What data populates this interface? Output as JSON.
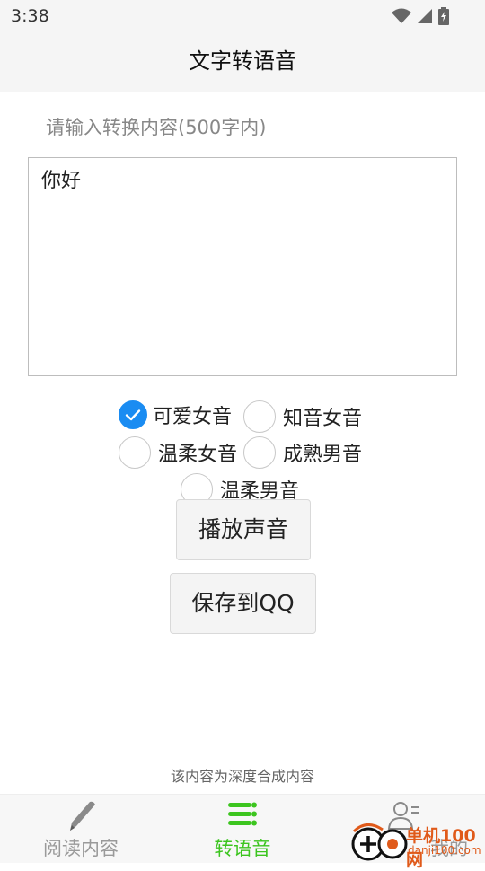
{
  "status_bar": {
    "time": "3:38"
  },
  "app_bar": {
    "title": "文字转语音"
  },
  "form": {
    "prompt_label": "请输入转换内容(500字内)",
    "text_value": "你好"
  },
  "voices": {
    "options": [
      {
        "label": "可爱女音",
        "checked": true
      },
      {
        "label": "知音女音",
        "checked": false
      },
      {
        "label": "温柔女音",
        "checked": false
      },
      {
        "label": "成熟男音",
        "checked": false
      },
      {
        "label": "温柔男音",
        "checked": false
      }
    ]
  },
  "buttons": {
    "play_label": "播放声音",
    "save_label": "保存到QQ"
  },
  "footnote": "该内容为深度合成内容",
  "bottom_nav": {
    "items": [
      {
        "label": "阅读内容",
        "active": false
      },
      {
        "label": "转语音",
        "active": true
      },
      {
        "label": "我的",
        "active": false
      }
    ]
  },
  "colors": {
    "accent": "#1a8cf2",
    "nav_active": "#3cc51f",
    "nav_inactive": "#9a9a9a"
  },
  "watermark": {
    "line1": "单机100网",
    "line2": "danji100.com"
  }
}
